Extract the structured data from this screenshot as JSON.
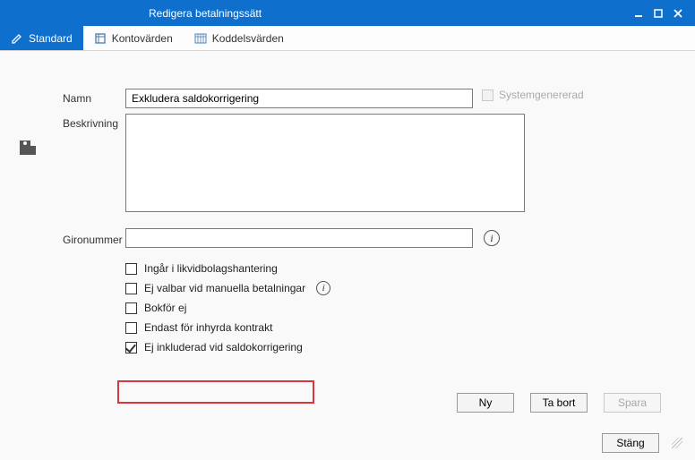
{
  "window": {
    "title": "Redigera betalningssätt"
  },
  "ribbon": {
    "tab_standard": "Standard",
    "tab_kontovarden": "Kontovärden",
    "tab_koddelsvarden": "Koddelsvärden"
  },
  "form": {
    "name_label": "Namn",
    "name_value": "Exkludera saldokorrigering",
    "systemgenerated_label": "Systemgenererad",
    "systemgenerated_checked": false,
    "description_label": "Beskrivning",
    "description_value": "",
    "gironumber_label": "Gironummer",
    "gironumber_value": ""
  },
  "checkboxes": [
    {
      "key": "ingar",
      "label": "Ingår i likvidbolagshantering",
      "checked": false,
      "info": false
    },
    {
      "key": "ejvalbar",
      "label": "Ej valbar vid manuella betalningar",
      "checked": false,
      "info": true
    },
    {
      "key": "bokforej",
      "label": "Bokför ej",
      "checked": false,
      "info": false
    },
    {
      "key": "endast",
      "label": "Endast för inhyrda kontrakt",
      "checked": false,
      "info": false
    },
    {
      "key": "ejinkl",
      "label": "Ej inkluderad vid saldokorrigering",
      "checked": true,
      "info": false
    }
  ],
  "buttons": {
    "ny": "Ny",
    "tabort": "Ta bort",
    "spara": "Spara",
    "stang": "Stäng"
  },
  "info_glyph": "i"
}
